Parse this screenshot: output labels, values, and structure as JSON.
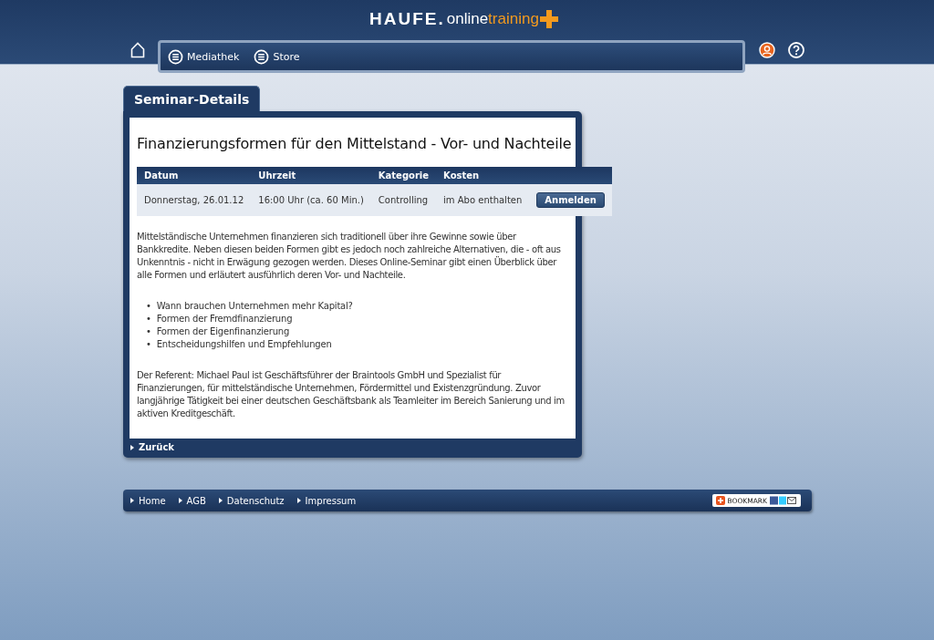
{
  "logo": {
    "brand": "HAUFE.",
    "part1": "online",
    "part2": "training"
  },
  "nav": [
    {
      "label": "Mediathek"
    },
    {
      "label": "Store"
    }
  ],
  "panel": {
    "tab": "Seminar-Details",
    "title": "Finanzierungsformen für den Mittelstand - Vor- und Nachteile",
    "table": {
      "columns": [
        "Datum",
        "Uhrzeit",
        "Kategorie",
        "Kosten"
      ],
      "row": [
        "Donnerstag, 26.01.12",
        "16:00 Uhr (ca. 60 Min.)",
        "Controlling",
        "im Abo enthalten"
      ],
      "button": "Anmelden"
    },
    "intro": "Mittelständische Unternehmen finanzieren sich traditionell über ihre Gewinne sowie über Bankkredite. Neben diesen beiden Formen gibt es jedoch noch zahlreiche Alternativen, die - oft aus Unkenntnis - nicht in Erwägung gezogen werden. Dieses Online-Seminar gibt einen Überblick über alle Formen und erläutert ausführlich deren Vor- und Nachteile.",
    "bullet_marker": "•",
    "bullets": [
      "Wann brauchen Unternehmen mehr Kapital?",
      "Formen der Fremdfinanzierung",
      "Formen der Eigenfinanzierung",
      "Entscheidungshilfen und Empfehlungen"
    ],
    "speaker": "Der Referent: Michael Paul ist Geschäftsführer der Braintools GmbH und Spezialist für Finanzierungen, für mittelständische Unternehmen, Fördermittel und Existenzgründung. Zuvor langjährige Tätigkeit bei einer deutschen Geschäftsbank als Teamleiter im Bereich Sanierung und im aktiven Kreditgeschäft.",
    "back": "Zurück"
  },
  "footer": {
    "links": [
      "Home",
      "AGB",
      "Datenschutz",
      "Impressum"
    ],
    "bookmark": "BOOKMARK"
  }
}
